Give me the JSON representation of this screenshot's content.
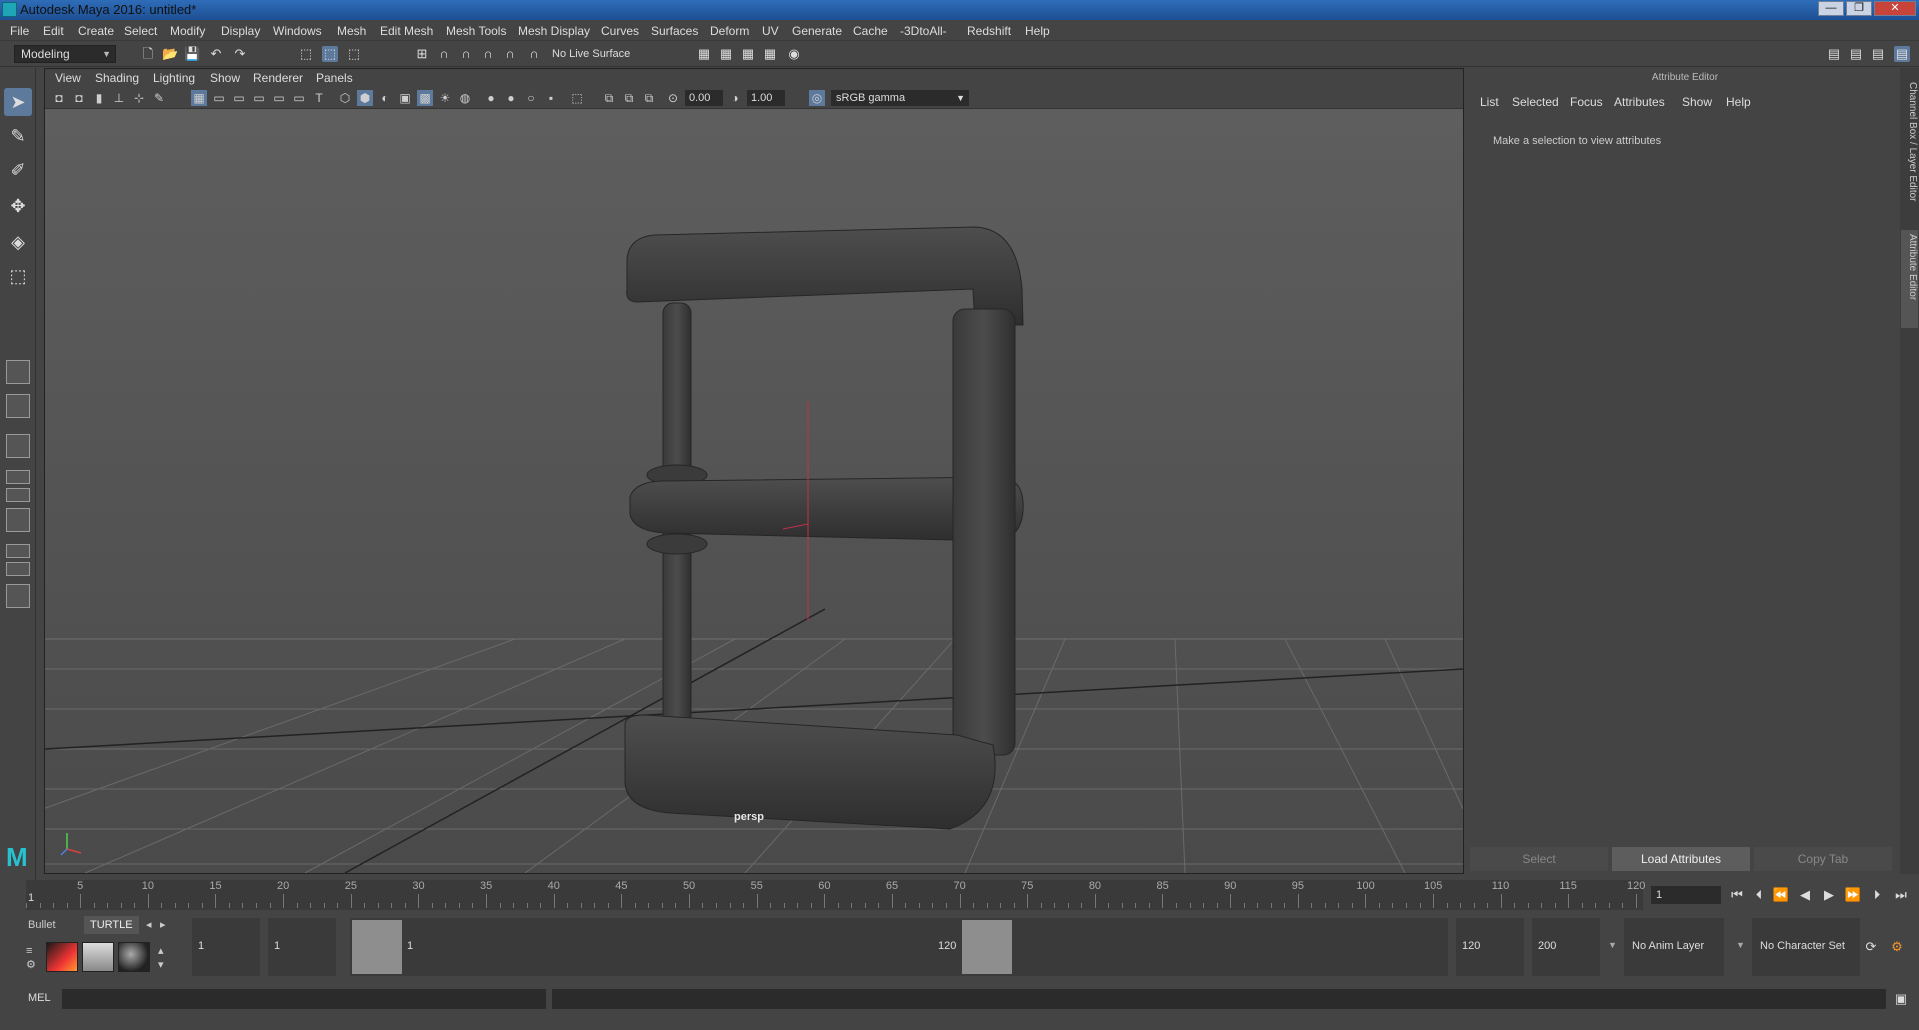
{
  "window": {
    "title": "Autodesk Maya 2016: untitled*",
    "controls": [
      "—",
      "❐",
      "✕"
    ]
  },
  "menubar": [
    "File",
    "Edit",
    "Create",
    "Select",
    "Modify",
    "Display",
    "Windows",
    "Mesh",
    "Edit Mesh",
    "Mesh Tools",
    "Mesh Display",
    "Curves",
    "Surfaces",
    "Deform",
    "UV",
    "Generate",
    "Cache",
    "-3DtoAll-",
    "Redshift",
    "Help"
  ],
  "statusline": {
    "mode": "Modeling",
    "live_surface": "No Live Surface"
  },
  "viewport": {
    "panel_menu": [
      "View",
      "Shading",
      "Lighting",
      "Show",
      "Renderer",
      "Panels"
    ],
    "exposure": "0.00",
    "gamma": "1.00",
    "color_space": "sRGB gamma",
    "camera_label": "persp"
  },
  "attribute_editor": {
    "title": "Attribute Editor",
    "menu": [
      "List",
      "Selected",
      "Focus",
      "Attributes",
      "Show",
      "Help"
    ],
    "message": "Make a selection to view attributes",
    "buttons": {
      "select": "Select",
      "load": "Load Attributes",
      "copy": "Copy Tab"
    },
    "side_tabs": [
      "Channel Box / Layer Editor",
      "Attribute Editor"
    ]
  },
  "timeline": {
    "start": "1",
    "ticks": [
      "5",
      "10",
      "15",
      "20",
      "25",
      "30",
      "35",
      "40",
      "45",
      "50",
      "55",
      "60",
      "65",
      "70",
      "75",
      "80",
      "85",
      "90",
      "95",
      "100",
      "105",
      "110",
      "115",
      "120"
    ],
    "first_label": "1",
    "current_frame": "1"
  },
  "shelf": {
    "tabs": [
      "Bullet",
      "TURTLE"
    ]
  },
  "range": {
    "start_time": "1",
    "playback_start": "1",
    "range_start_label": "1",
    "range_end_label": "120",
    "playback_end": "120",
    "end_time": "200",
    "anim_layer": "No Anim Layer",
    "character_set": "No Character Set"
  },
  "command_line": {
    "label": "MEL"
  }
}
